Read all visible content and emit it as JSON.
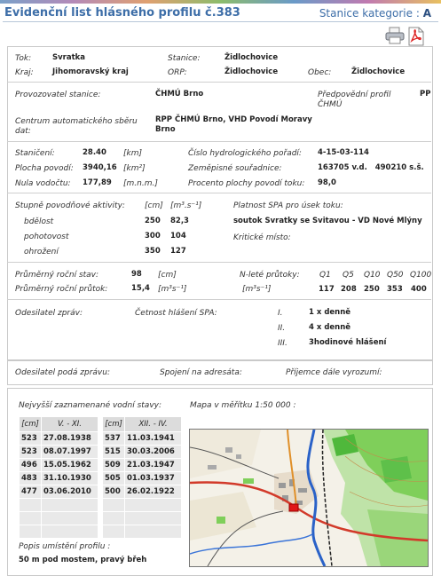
{
  "header": {
    "title": "Evidenční list hlásného profilu č.383",
    "kategorie_label": "Stanice kategorie :",
    "kategorie_value": "A"
  },
  "icons": [
    "printer-icon",
    "pdf-icon"
  ],
  "loc": {
    "tok_l": "Tok:",
    "tok_v": "Svratka",
    "stanice_l": "Stanice:",
    "stanice_v": "Židlochovice",
    "kraj_l": "Kraj:",
    "kraj_v": "Jihomoravský kraj",
    "orp_l": "ORP:",
    "orp_v": "Židlochovice",
    "obec_l": "Obec:",
    "obec_v": "Židlochovice"
  },
  "prov": {
    "prov_l": "Provozovatel stanice:",
    "prov_v": "ČHMÚ Brno",
    "pred_l1": "Předpovědní profil",
    "pred_l2": "ČHMÚ",
    "pred_v": "PP",
    "cent_l1": "Centrum automatického sběru",
    "cent_l2": "dat:",
    "cent_v1": "RPP ČHMÚ Brno, VHD Povodí Moravy",
    "cent_v2": "Brno"
  },
  "hydro": {
    "stan_l": "Staničení:",
    "stan_v": "28.40",
    "stan_u": "[km]",
    "plocha_l": "Plocha povodí:",
    "plocha_v": "3940,16",
    "plocha_u": "[km²]",
    "nula_l": "Nula vodočtu:",
    "nula_v": "177,89",
    "nula_u": "[m.n.m.]",
    "cislo_l": "Číslo hydrologického pořadí:",
    "cislo_v": "4-15-03-114",
    "zem_l": "Zeměpisné souřadnice:",
    "zem_v": "163705 v.d.   490210 s.š.",
    "proc_l": "Procento plochy povodí toku:",
    "proc_v": "98,0"
  },
  "spa": {
    "stupne_l": "Stupně povodňové aktivity:",
    "unit_cm": "[cm]",
    "unit_q": "[m³.s⁻¹]",
    "levels": [
      {
        "name": "bdělost",
        "cm": "250",
        "q": "82,3"
      },
      {
        "name": "pohotovost",
        "cm": "300",
        "q": "104"
      },
      {
        "name": "ohrožení",
        "cm": "350",
        "q": "127"
      }
    ],
    "platnost_l": "Platnost SPA pro úsek toku:",
    "platnost_v": "soutok Svratky se Svitavou - VD Nové Mlýny",
    "kriticke_l": "Kritické místo:"
  },
  "prumer": {
    "stav_l": "Průměrný roční stav:",
    "stav_v": "98",
    "stav_u": "[cm]",
    "prutok_l": "Průměrný roční průtok:",
    "prutok_v": "15,4",
    "prutok_u": "[m³s⁻¹]",
    "nlete_l": "N-leté průtoky:",
    "nlete_u": "[m³s⁻¹]",
    "q_labels": [
      "Q1",
      "Q5",
      "Q10",
      "Q50",
      "Q100"
    ],
    "q_values": [
      "117",
      "208",
      "250",
      "353",
      "400"
    ]
  },
  "odesilatel": {
    "l": "Odesilatel zpráv:",
    "cetnost_l": "Četnost hlášení SPA:",
    "items": [
      {
        "roman": "I.",
        "text": "1 x denně"
      },
      {
        "roman": "II.",
        "text": "4 x denně"
      },
      {
        "roman": "III.",
        "text": "3hodinové hlášení"
      }
    ]
  },
  "podsprava": {
    "odes_l": "Odesilatel podá zprávu:",
    "spoj_l": "Spojení na adresáta:",
    "prij_l": "Příjemce dále vyrozumí:"
  },
  "stavy": {
    "title": "Nejvyšší zaznamenané vodní stavy:",
    "h1": [
      "[cm]",
      "V. - XI."
    ],
    "h2": [
      "[cm]",
      "XII. - IV."
    ],
    "rows": [
      [
        "523",
        "27.08.1938",
        "537",
        "11.03.1941"
      ],
      [
        "523",
        "08.07.1997",
        "515",
        "30.03.2006"
      ],
      [
        "496",
        "15.05.1962",
        "509",
        "21.03.1947"
      ],
      [
        "483",
        "31.10.1930",
        "505",
        "01.03.1937"
      ],
      [
        "477",
        "03.06.2010",
        "500",
        "26.02.1922"
      ],
      [
        "",
        "",
        "",
        ""
      ],
      [
        "",
        "",
        "",
        ""
      ],
      [
        "",
        "",
        "",
        ""
      ]
    ]
  },
  "mapa": {
    "title": "Mapa v měřítku 1:50 000 :"
  },
  "popis": {
    "l": "Popis umístění profilu :",
    "v": "50 m pod mostem, pravý břeh"
  }
}
